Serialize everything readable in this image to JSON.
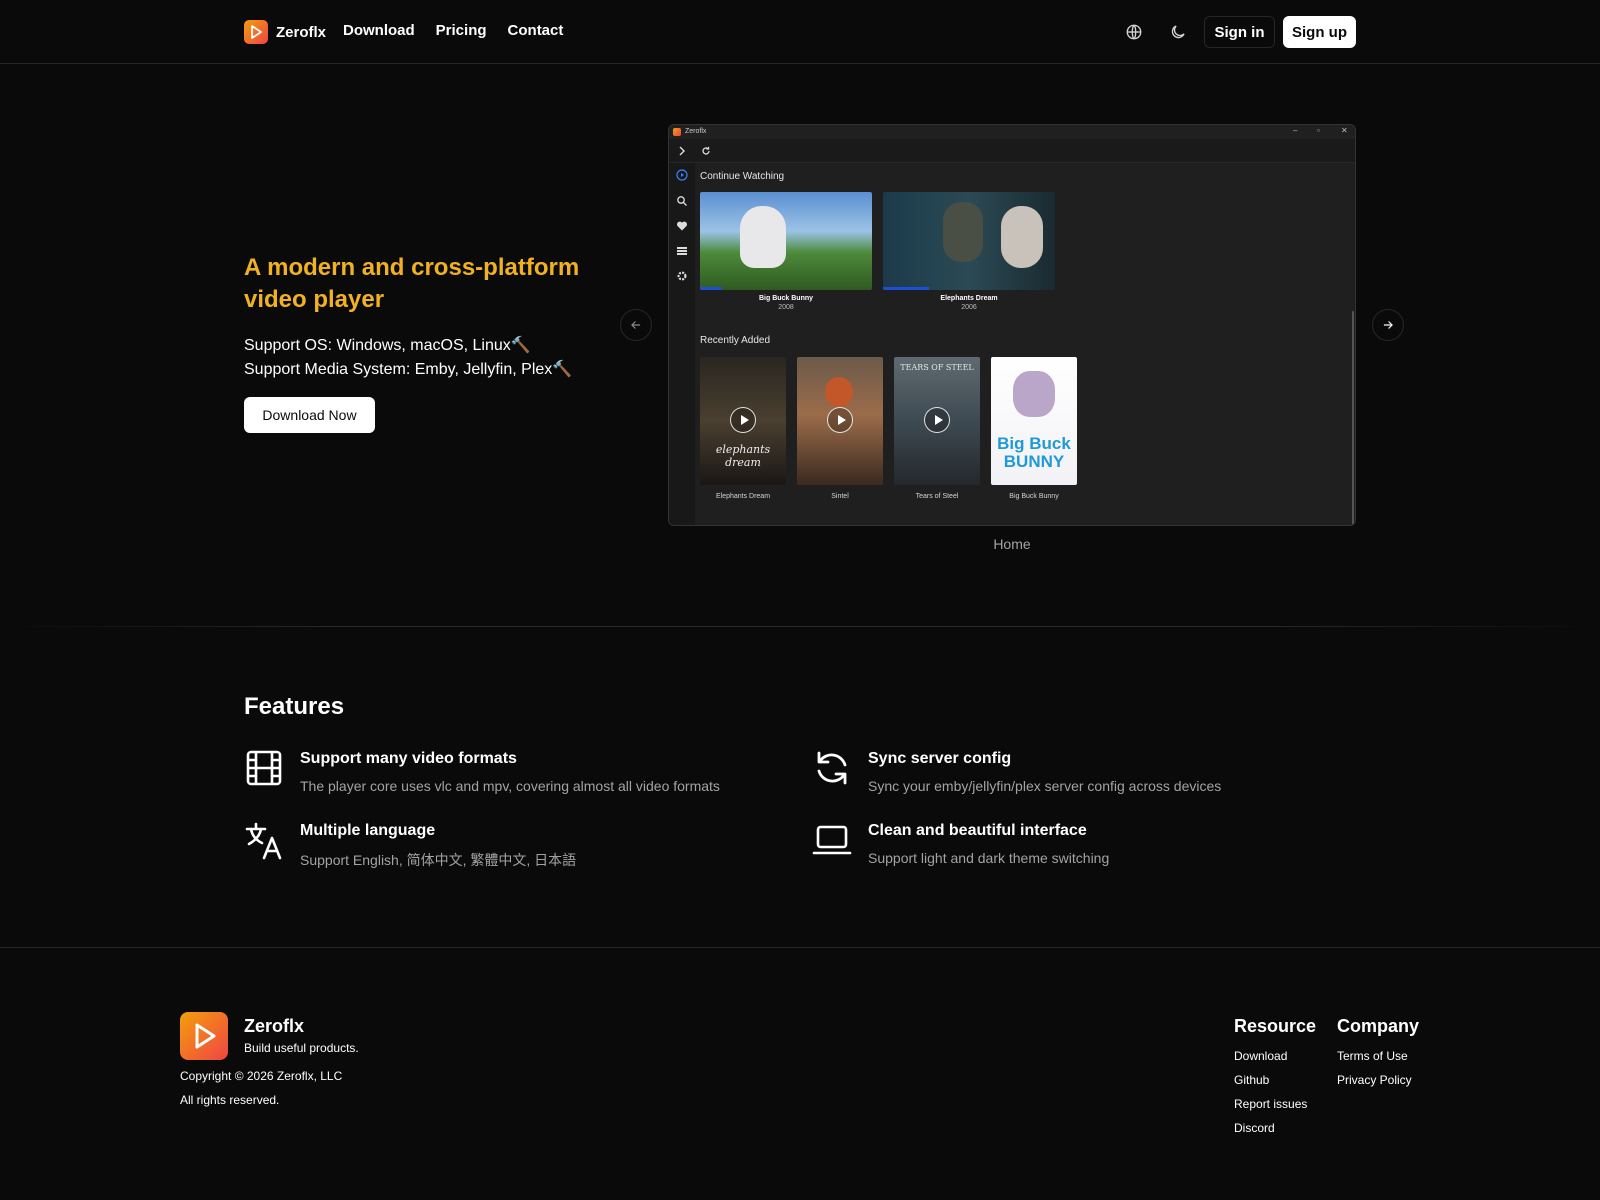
{
  "header": {
    "brand": "Zeroflx",
    "nav": [
      "Download",
      "Pricing",
      "Contact"
    ],
    "icons": [
      "globe-icon",
      "moon-icon"
    ],
    "sign_in": "Sign in",
    "sign_up": "Sign up"
  },
  "hero": {
    "title": "A modern and cross-platform video player",
    "os_line": "Support OS: Windows, macOS, Linux🔨",
    "media_line": "Support Media System: Emby, Jellyfin, Plex🔨",
    "download_button": "Download Now",
    "caption": "Home"
  },
  "app_window": {
    "title": "Zeroflx",
    "continue_watching_title": "Continue Watching",
    "continue_watching": [
      {
        "name": "Big Buck Bunny",
        "year": "2008",
        "progress": 0.13
      },
      {
        "name": "Elephants Dream",
        "year": "2006",
        "progress": 0.27
      }
    ],
    "recently_added_title": "Recently Added",
    "recently_added": [
      {
        "name": "Elephants Dream",
        "poster_text": "elephants dream"
      },
      {
        "name": "Sintel",
        "poster_text": ""
      },
      {
        "name": "Tears of Steel",
        "poster_text": "TEARS OF STEEL"
      },
      {
        "name": "Big Buck Bunny",
        "poster_text": "Big Buck BUNNY"
      }
    ]
  },
  "features": {
    "title": "Features",
    "items": [
      {
        "icon": "film-icon",
        "title": "Support many video formats",
        "desc": "The player core uses vlc and mpv, covering almost all video formats"
      },
      {
        "icon": "sync-icon",
        "title": "Sync server config",
        "desc": "Sync your emby/jellyfin/plex server config across devices"
      },
      {
        "icon": "language-icon",
        "title": "Multiple language",
        "desc": "Support English, 简体中文, 繁體中文, 日本語"
      },
      {
        "icon": "laptop-icon",
        "title": "Clean and beautiful interface",
        "desc": "Support light and dark theme switching"
      }
    ]
  },
  "footer": {
    "brand": "Zeroflx",
    "tagline": "Build useful products.",
    "copyright": "Copyright © 2026 Zeroflx, LLC",
    "rights": "All rights reserved.",
    "resource_title": "Resource",
    "resource_links": [
      "Download",
      "Github",
      "Report issues",
      "Discord"
    ],
    "company_title": "Company",
    "company_links": [
      "Terms of Use",
      "Privacy Policy"
    ]
  },
  "colors": {
    "background": "#0a0a0a",
    "accent": "#f2b21f",
    "muted_text": "#a3a3a3",
    "border": "#27272a",
    "progress": "#1d4ed8"
  }
}
